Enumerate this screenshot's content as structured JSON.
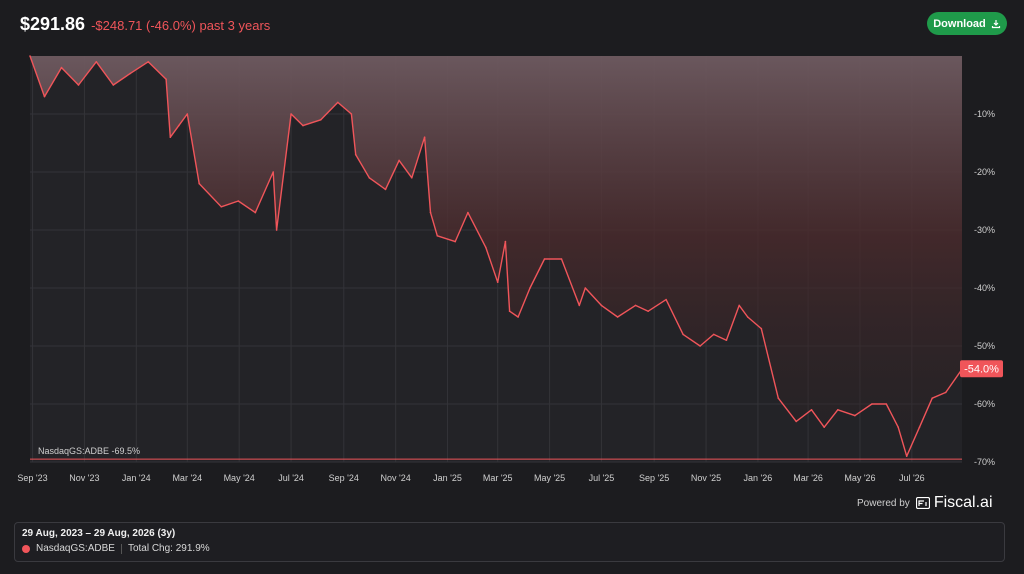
{
  "header": {
    "price": "$291.86",
    "change": "-$248.71 (-46.0%) past 3 years"
  },
  "toolbar": {
    "download_label": "Download",
    "download_icon": "download-icon"
  },
  "colors": {
    "accent_line": "#f0555a",
    "download_bg": "#1f9a4a",
    "background": "#1c1c1f"
  },
  "chart_data": {
    "type": "line",
    "series": [
      {
        "name": "NasdaqGS:ADBE",
        "x": [
          "2023-08-29",
          "2023-09-15",
          "2023-10-05",
          "2023-10-25",
          "2023-11-15",
          "2023-12-05",
          "2023-12-25",
          "2024-01-15",
          "2024-02-05",
          "2024-02-10",
          "2024-02-20",
          "2024-03-01",
          "2024-03-15",
          "2024-04-10",
          "2024-04-30",
          "2024-05-20",
          "2024-06-10",
          "2024-06-14",
          "2024-07-01",
          "2024-07-15",
          "2024-08-05",
          "2024-08-25",
          "2024-09-10",
          "2024-09-15",
          "2024-10-01",
          "2024-10-20",
          "2024-11-05",
          "2024-11-20",
          "2024-12-05",
          "2024-12-12",
          "2024-12-20",
          "2025-01-10",
          "2025-01-25",
          "2025-02-15",
          "2025-03-01",
          "2025-03-10",
          "2025-03-15",
          "2025-03-25",
          "2025-04-08",
          "2025-04-25",
          "2025-05-15",
          "2025-06-05",
          "2025-06-12",
          "2025-07-01",
          "2025-07-20",
          "2025-08-10",
          "2025-08-25",
          "2025-09-15",
          "2025-10-05",
          "2025-10-25",
          "2025-11-10",
          "2025-11-25",
          "2025-12-10",
          "2025-12-20",
          "2026-01-05",
          "2026-01-25",
          "2026-02-15",
          "2026-03-05",
          "2026-03-20",
          "2026-04-05",
          "2026-04-25",
          "2026-05-15",
          "2026-06-01",
          "2026-06-15",
          "2026-06-25",
          "2026-07-10",
          "2026-07-25",
          "2026-08-10",
          "2026-08-29"
        ],
        "values": [
          0,
          -7,
          -2,
          -5,
          -1,
          -5,
          -3,
          -1,
          -4,
          -14,
          -12,
          -10,
          -22,
          -26,
          -25,
          -27,
          -20,
          -30,
          -10,
          -12,
          -11,
          -8,
          -10,
          -17,
          -21,
          -23,
          -18,
          -21,
          -14,
          -27,
          -31,
          -32,
          -27,
          -33,
          -39,
          -32,
          -44,
          -45,
          -40,
          -35,
          -35,
          -43,
          -40,
          -43,
          -45,
          -43,
          -44,
          -42,
          -48,
          -50,
          -48,
          -49,
          -43,
          -45,
          -47,
          -59,
          -63,
          -61,
          -64,
          -61,
          -62,
          -60,
          -60,
          -64,
          -69,
          -64,
          -59,
          -58,
          -54
        ]
      }
    ],
    "y_ticks": [
      "-10%",
      "-20%",
      "-30%",
      "-40%",
      "-50%",
      "-60%",
      "-70%"
    ],
    "y_tick_values": [
      -10,
      -20,
      -30,
      -40,
      -50,
      -60,
      -70
    ],
    "x_ticks": [
      "Sep '23",
      "Nov '23",
      "Jan '24",
      "Mar '24",
      "May '24",
      "Jul '24",
      "Sep '24",
      "Nov '24",
      "Jan '25",
      "Mar '25",
      "May '25",
      "Jul '25",
      "Sep '25",
      "Nov '25",
      "Jan '26",
      "Mar '26",
      "May '26",
      "Jul '26"
    ],
    "x_tick_dates": [
      "2023-09-01",
      "2023-11-01",
      "2024-01-01",
      "2024-03-01",
      "2024-05-01",
      "2024-07-01",
      "2024-09-01",
      "2024-11-01",
      "2025-01-01",
      "2025-03-01",
      "2025-05-01",
      "2025-07-01",
      "2025-09-01",
      "2025-11-01",
      "2026-01-01",
      "2026-03-01",
      "2026-05-01",
      "2026-07-01"
    ],
    "x_range": [
      "2023-08-29",
      "2026-08-29"
    ],
    "ylim": [
      -70,
      0
    ],
    "last_value_label": "-54.0%",
    "reference_label": "NasdaqGS:ADBE -69.5%",
    "reference_value": -69.5,
    "grid": true,
    "y_axis_side": "right"
  },
  "branding": {
    "powered_by": "Powered by",
    "brand_name": "Fiscal.ai"
  },
  "info_panel": {
    "date_range": "29 Aug, 2023 – 29 Aug, 2026 (3y)",
    "ticker": "NasdaqGS:ADBE",
    "total_change": "Total Chg: 291.9%"
  }
}
